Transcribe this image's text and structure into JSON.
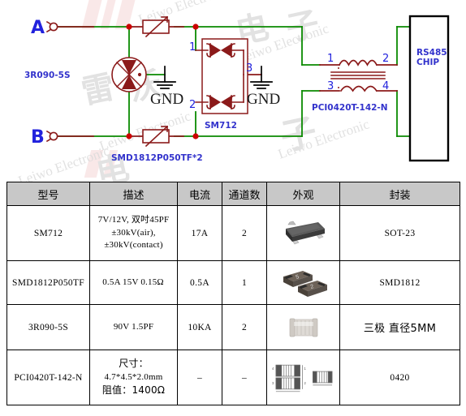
{
  "schematic": {
    "title": "RS485 port protection circuit",
    "colors": {
      "wire_green": "#0a8a00",
      "component_red": "#8b1a1a",
      "label_blue": "#3333cc",
      "chip_border": "#000000"
    },
    "port_labels": [
      {
        "name": "port-a",
        "text": "A"
      },
      {
        "name": "port-b",
        "text": "B"
      }
    ],
    "component_labels": [
      {
        "name": "gdt-label",
        "text": "3R090-5S"
      },
      {
        "name": "ptc-label",
        "text": "SMD1812P050TF*2"
      },
      {
        "name": "tvs-label",
        "text": "SM712"
      },
      {
        "name": "choke-label",
        "text": "PCI0420T-142-N"
      }
    ],
    "ground_labels": [
      "GND",
      "GND"
    ],
    "tvs_pins": [
      "1",
      "2",
      "3"
    ],
    "choke_pins": [
      "1",
      "2",
      "3",
      "4"
    ],
    "chip": {
      "line1": "RS485",
      "line2": "CHIP"
    }
  },
  "watermark": {
    "latin": "Leiwo Electronic",
    "cn1": "雷",
    "cn2": "沃",
    "cn3": "电",
    "cn4": "子"
  },
  "table": {
    "headers": [
      {
        "name": "col-model",
        "label": "型号"
      },
      {
        "name": "col-description",
        "label": "描述"
      },
      {
        "name": "col-current",
        "label": "电流"
      },
      {
        "name": "col-channels",
        "label": "通道数"
      },
      {
        "name": "col-appearance",
        "label": "外观"
      },
      {
        "name": "col-package",
        "label": "封装"
      }
    ],
    "rows": [
      {
        "model": "SM712",
        "desc_lines": [
          "7V/12V, 双吋45PF",
          "±30kV(air),",
          "±30kV(contact)"
        ],
        "current": "17A",
        "channels": "2",
        "appearance": "sot23-package-photo",
        "package": "SOT-23"
      },
      {
        "model": "SMD1812P050TF",
        "desc_lines": [
          "0.5A 15V 0.15Ω"
        ],
        "current": "0.5A",
        "channels": "1",
        "appearance": "smd1812-package-photo",
        "package": "SMD1812"
      },
      {
        "model": "3R090-5S",
        "desc_lines": [
          "90V 1.5PF"
        ],
        "current": "10KA",
        "channels": "2",
        "appearance": "gdt-tube-photo",
        "package": "三极 直径5MM"
      },
      {
        "model": "PCI0420T-142-N",
        "desc_lines": [
          "尺寸：",
          "4.7*4.5*2.0mm",
          "阻值：1400Ω"
        ],
        "current": "–",
        "channels": "–",
        "appearance": "choke-drawing",
        "package": "0420"
      }
    ]
  }
}
